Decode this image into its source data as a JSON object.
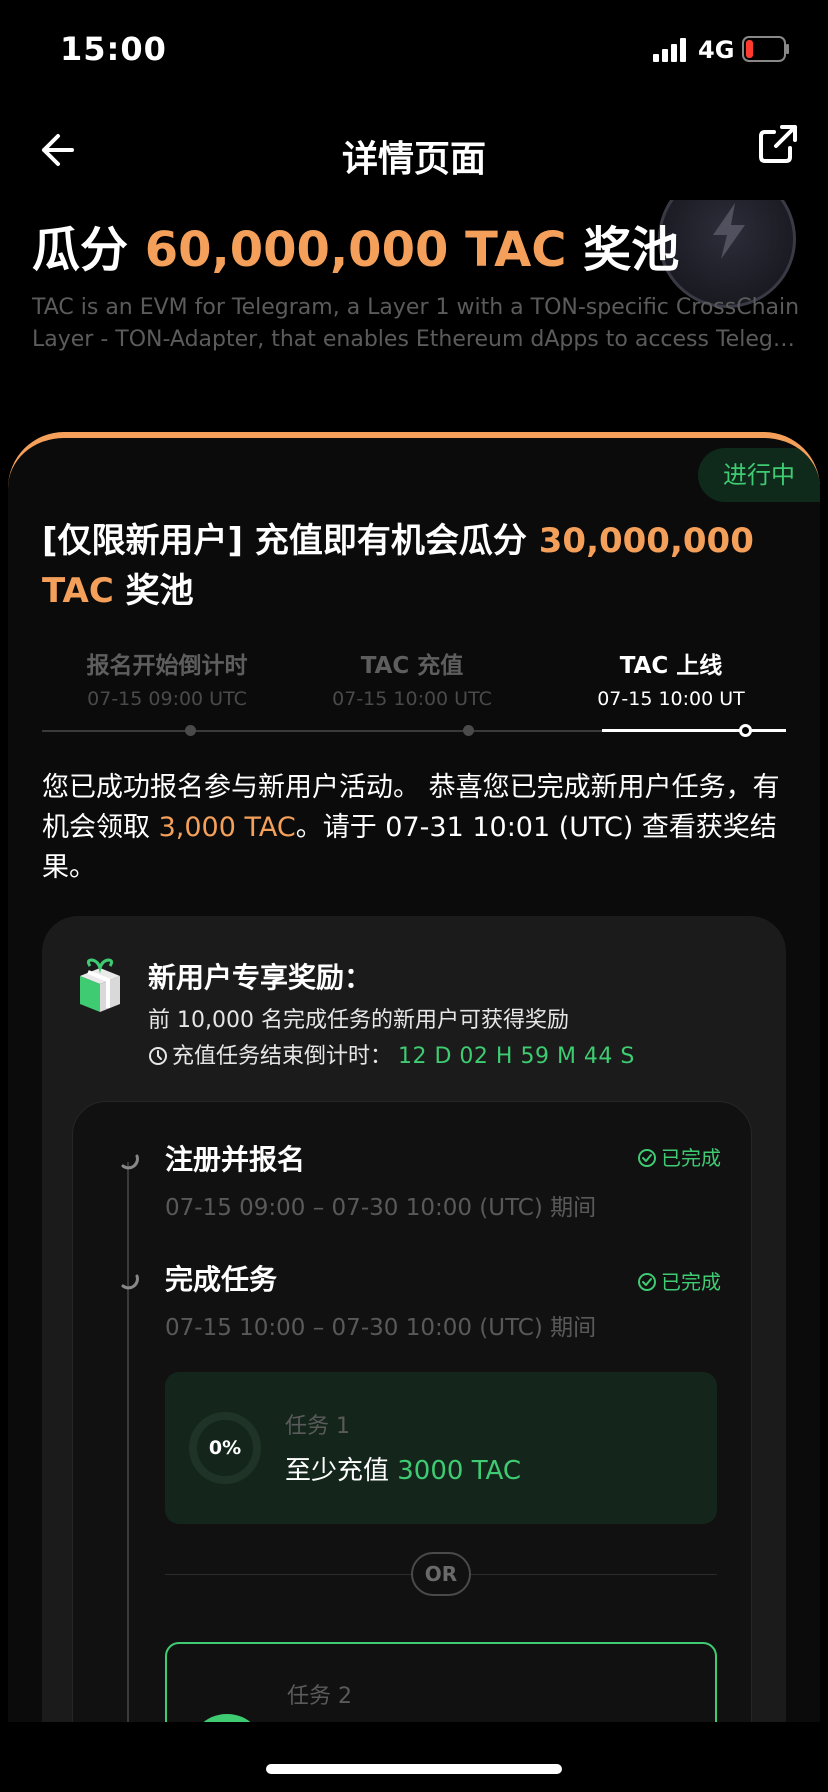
{
  "status_bar": {
    "time": "15:00",
    "network": "4G"
  },
  "nav": {
    "title": "详情页面"
  },
  "hero": {
    "title_prefix": "瓜分 ",
    "title_amount": "60,000,000 TAC",
    "title_suffix": " 奖池",
    "description_line1": "TAC is an EVM for Telegram, a Layer 1 with a TON-specific CrossChain",
    "description_line2": "Layer - TON-Adapter, that enables Ethereum dApps to access Telegra..."
  },
  "card": {
    "status": "进行中",
    "title_prefix": "[仅限新用户] 充值即有机会瓜分 ",
    "title_amount": "30,000,000 TAC",
    "title_suffix": " 奖池"
  },
  "timeline": [
    {
      "name": "报名开始倒计时",
      "date": "07-15 09:00 UTC",
      "active": false
    },
    {
      "name": "TAC 充值",
      "date": "07-15 10:00 UTC",
      "active": false
    },
    {
      "name": "TAC 上线",
      "date": "07-15 10:00 UT",
      "active": true
    }
  ],
  "message": {
    "part1": "您已成功报名参与新用户活动。 恭喜您已完成新用户任务，有机会领取 ",
    "amount": "3,000 TAC",
    "part2": "。请于 07-31 10:01 (UTC) 查看获奖结果。"
  },
  "reward": {
    "title": "新用户专享奖励：",
    "subtitle": "前 10,000 名完成任务的新用户可获得奖励",
    "countdown_label": "充值任务结束倒计时：",
    "countdown_value": "12 D  02 H  59 M  44 S"
  },
  "steps": [
    {
      "title": "注册并报名",
      "period": "07-15 09:00 – 07-30 10:00 (UTC) 期间",
      "status": "已完成"
    },
    {
      "title": "完成任务",
      "period": "07-15 10:00 – 07-30 10:00 (UTC) 期间",
      "status": "已完成"
    }
  ],
  "tasks": [
    {
      "label": "任务 1",
      "desc_prefix": "至少充值 ",
      "desc_amount": "3000 TAC",
      "progress": "0%"
    },
    {
      "label": "任务 2"
    }
  ],
  "or_label": "OR",
  "colors": {
    "accent": "#f5a05a",
    "success": "#3ecb72",
    "background": "#000000"
  }
}
